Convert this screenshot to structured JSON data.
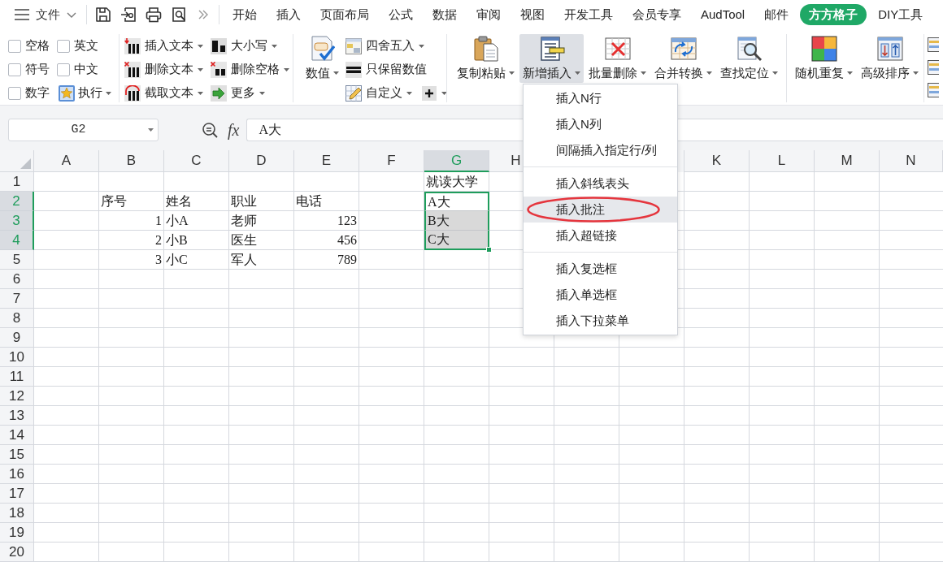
{
  "menubar": {
    "file_menu": "文件",
    "tabs": [
      {
        "label": "开始",
        "selected": false
      },
      {
        "label": "插入",
        "selected": false
      },
      {
        "label": "页面布局",
        "selected": false
      },
      {
        "label": "公式",
        "selected": false
      },
      {
        "label": "数据",
        "selected": false
      },
      {
        "label": "审阅",
        "selected": false
      },
      {
        "label": "视图",
        "selected": false
      },
      {
        "label": "开发工具",
        "selected": false
      },
      {
        "label": "会员专享",
        "selected": false
      },
      {
        "label": "AudTool",
        "selected": false
      },
      {
        "label": "邮件",
        "selected": false
      },
      {
        "label": "方方格子",
        "selected": true
      },
      {
        "label": "DIY工具",
        "selected": false
      }
    ]
  },
  "ribbon": {
    "options": [
      {
        "label": "空格",
        "checked": false
      },
      {
        "label": "英文",
        "checked": false
      },
      {
        "label": "符号",
        "checked": false
      },
      {
        "label": "中文",
        "checked": false
      },
      {
        "label": "数字",
        "checked": false
      }
    ],
    "run_button": {
      "label": "执行",
      "dropdown": true
    },
    "text_tools": [
      {
        "label": "插入文本",
        "dropdown": true
      },
      {
        "label": "删除文本",
        "dropdown": true
      },
      {
        "label": "截取文本",
        "dropdown": true
      }
    ],
    "case_tools": [
      {
        "label": "大小写",
        "dropdown": true
      },
      {
        "label": "删除空格",
        "dropdown": true
      },
      {
        "label": "更多",
        "dropdown": true
      }
    ],
    "number_button": {
      "label": "数值",
      "dropdown": true
    },
    "number_tools": [
      {
        "label": "四舍五入",
        "dropdown": true
      },
      {
        "label": "只保留数值",
        "dropdown": false
      },
      {
        "label": "自定义",
        "dropdown": true
      }
    ],
    "plus_button": {
      "dropdown": true
    },
    "edit_tools": [
      {
        "label": "复制粘贴",
        "pressed": false
      },
      {
        "label": "新增插入",
        "pressed": true
      },
      {
        "label": "批量删除",
        "pressed": false
      },
      {
        "label": "合并转换",
        "pressed": false
      },
      {
        "label": "查找定位",
        "pressed": false
      }
    ],
    "data_tools": [
      {
        "label": "随机重复",
        "pressed": false
      },
      {
        "label": "高级排序",
        "pressed": false
      }
    ]
  },
  "formula_bar": {
    "name_box": "G2",
    "function_label": "fx",
    "formula": "A大"
  },
  "sheet": {
    "columns": [
      {
        "label": "A",
        "selected": false
      },
      {
        "label": "B",
        "selected": false
      },
      {
        "label": "C",
        "selected": false
      },
      {
        "label": "D",
        "selected": false
      },
      {
        "label": "E",
        "selected": false
      },
      {
        "label": "F",
        "selected": false
      },
      {
        "label": "G",
        "selected": true
      },
      {
        "label": "H",
        "selected": false
      }
    ],
    "columns_right": [
      {
        "label": "K",
        "selected": false
      },
      {
        "label": "L",
        "selected": false
      },
      {
        "label": "M",
        "selected": false
      },
      {
        "label": "N",
        "selected": false
      }
    ],
    "rows": [
      {
        "label": "1",
        "selected": false,
        "cells": [
          null,
          null,
          null,
          null,
          null,
          null,
          {
            "text": "就读大学",
            "kind": "text",
            "selected": false,
            "active": false
          }
        ]
      },
      {
        "label": "2",
        "selected": true,
        "cells": [
          null,
          {
            "text": "序号",
            "kind": "text",
            "selected": false,
            "active": false
          },
          {
            "text": "姓名",
            "kind": "text",
            "selected": false,
            "active": false
          },
          {
            "text": "职业",
            "kind": "text",
            "selected": false,
            "active": false
          },
          {
            "text": "电话",
            "kind": "text",
            "selected": false,
            "active": false
          },
          null,
          {
            "text": "A大",
            "kind": "text",
            "selected": true,
            "active": true
          }
        ]
      },
      {
        "label": "3",
        "selected": true,
        "cells": [
          null,
          {
            "text": "1",
            "kind": "number",
            "selected": false,
            "active": false
          },
          {
            "text": "小A",
            "kind": "text",
            "selected": false,
            "active": false
          },
          {
            "text": "老师",
            "kind": "text",
            "selected": false,
            "active": false
          },
          {
            "text": "123",
            "kind": "number",
            "selected": false,
            "active": false
          },
          null,
          {
            "text": "B大",
            "kind": "text",
            "selected": true,
            "active": false
          }
        ]
      },
      {
        "label": "4",
        "selected": true,
        "cells": [
          null,
          {
            "text": "2",
            "kind": "number",
            "selected": false,
            "active": false
          },
          {
            "text": "小B",
            "kind": "text",
            "selected": false,
            "active": false
          },
          {
            "text": "医生",
            "kind": "text",
            "selected": false,
            "active": false
          },
          {
            "text": "456",
            "kind": "number",
            "selected": false,
            "active": false
          },
          null,
          {
            "text": "C大",
            "kind": "text",
            "selected": true,
            "active": false
          }
        ]
      },
      {
        "label": "5",
        "selected": false,
        "cells": [
          null,
          {
            "text": "3",
            "kind": "number",
            "selected": false,
            "active": false
          },
          {
            "text": "小C",
            "kind": "text",
            "selected": false,
            "active": false
          },
          {
            "text": "军人",
            "kind": "text",
            "selected": false,
            "active": false
          },
          {
            "text": "789",
            "kind": "number",
            "selected": false,
            "active": false
          }
        ]
      },
      {
        "label": "6",
        "selected": false
      },
      {
        "label": "7",
        "selected": false
      },
      {
        "label": "8",
        "selected": false
      },
      {
        "label": "9",
        "selected": false
      },
      {
        "label": "10",
        "selected": false
      },
      {
        "label": "11",
        "selected": false
      },
      {
        "label": "12",
        "selected": false
      },
      {
        "label": "13",
        "selected": false
      },
      {
        "label": "14",
        "selected": false
      },
      {
        "label": "15",
        "selected": false
      },
      {
        "label": "16",
        "selected": false
      },
      {
        "label": "17",
        "selected": false
      },
      {
        "label": "18",
        "selected": false
      },
      {
        "label": "19",
        "selected": false
      },
      {
        "label": "20",
        "selected": false
      }
    ]
  },
  "dropdown_menu": {
    "sections": [
      {
        "items": [
          {
            "label": "插入N行",
            "selected": false,
            "circled": false
          },
          {
            "label": "插入N列",
            "selected": false,
            "circled": false
          },
          {
            "label": "间隔插入指定行/列",
            "selected": false,
            "circled": false
          }
        ]
      },
      {
        "items": [
          {
            "label": "插入斜线表头",
            "selected": false,
            "circled": false
          },
          {
            "label": "插入批注",
            "selected": true,
            "circled": true
          },
          {
            "label": "插入超链接",
            "selected": false,
            "circled": false
          }
        ]
      },
      {
        "items": [
          {
            "label": "插入复选框",
            "selected": false,
            "circled": false
          },
          {
            "label": "插入单选框",
            "selected": false,
            "circled": false
          },
          {
            "label": "插入下拉菜单",
            "selected": false,
            "circled": false
          }
        ]
      }
    ]
  }
}
